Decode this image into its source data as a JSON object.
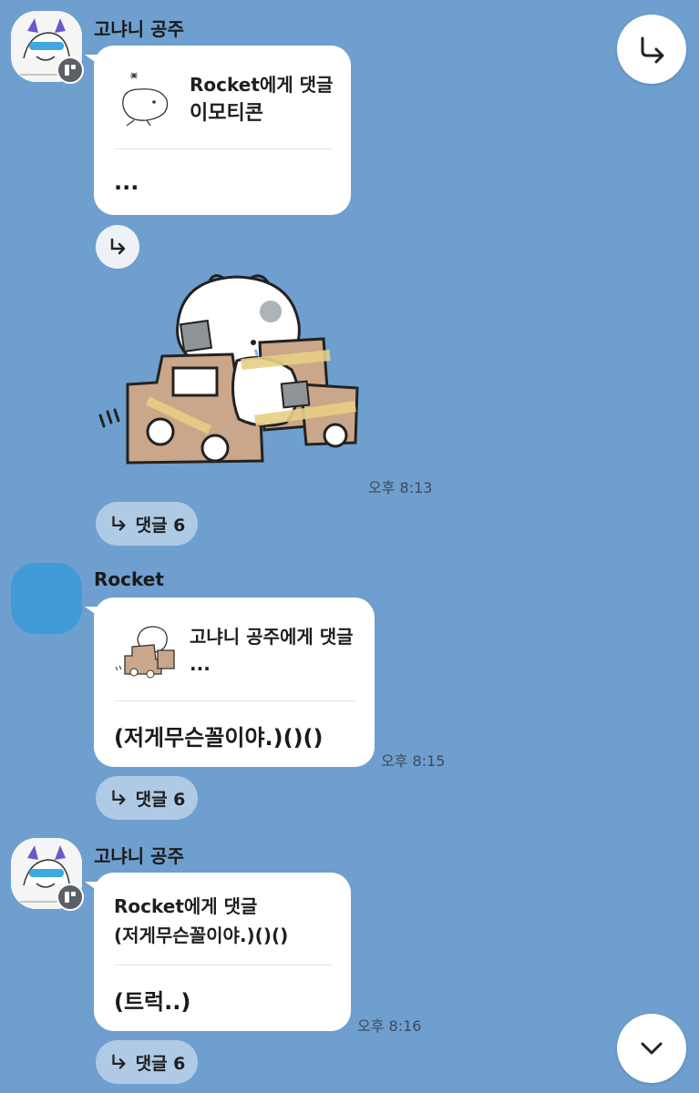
{
  "messages": [
    {
      "sender": "고냐니 공주",
      "reply_to": "Rocket에게 댓글",
      "reply_sub": "이모티콘",
      "text": "...",
      "time": "오후 8:13",
      "comments": "댓글 6"
    },
    {
      "sender": "Rocket",
      "reply_to": "고냐니 공주에게 댓글",
      "reply_sub": "...",
      "text": "(저게무슨꼴이야.)()()",
      "time": "오후 8:15",
      "comments": "댓글 6"
    },
    {
      "sender": "고냐니 공주",
      "reply_to": "Rocket에게 댓글",
      "reply_sub": "(저게무슨꼴이야.)()()",
      "text": "(트럭..)",
      "time": "오후 8:16",
      "comments": "댓글 6"
    }
  ],
  "icons": {
    "share": "share-arrow-icon",
    "reply": "reply-arrow-icon",
    "scroll_down": "chevron-down-icon"
  },
  "colors": {
    "background": "#6e9fcf",
    "bubble": "#ffffff",
    "rocket_avatar": "#3f9ad6"
  }
}
